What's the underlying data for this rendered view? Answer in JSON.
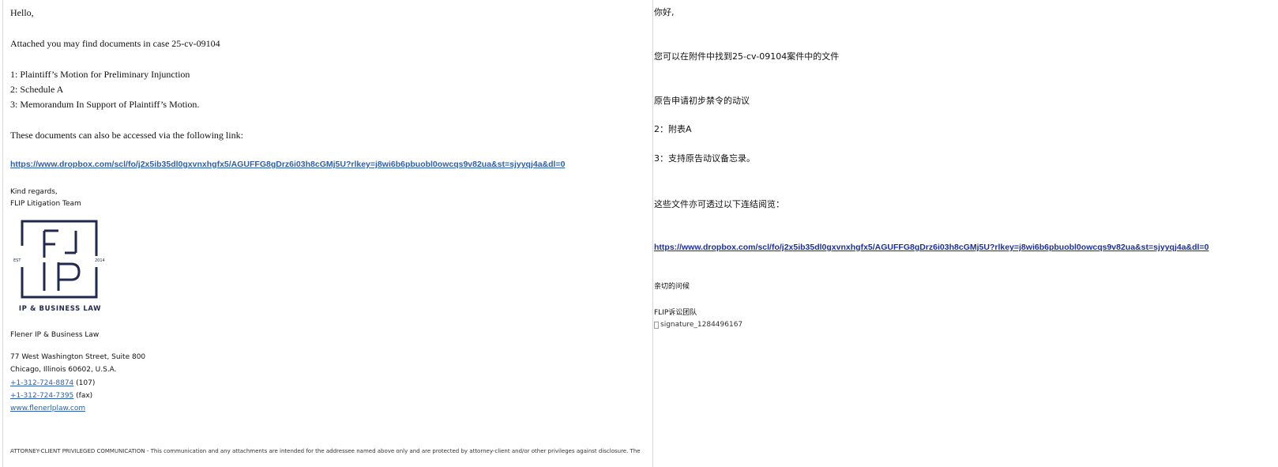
{
  "left": {
    "greeting": "Hello,",
    "intro": "Attached you may find documents in case 25-cv-09104",
    "docs": [
      "1:  Plaintiff’s Motion for Preliminary Injunction",
      "2: Schedule A",
      "3: Memorandum In Support of Plaintiff’s Motion."
    ],
    "access_text": "These documents can also be accessed via the following link:",
    "link": "https://www.dropbox.com/scl/fo/j2x5ib35dl0gxvnxhgfx5/AGUFFG8gDrz6i03h8cGMj5U?rlkey=j8wi6b6pbuobl0owcqs9v82ua&st=sjyyqj4a&dl=0",
    "regards": "Kind regards,",
    "team": "FLIP Litigation Team",
    "logo": {
      "letters_top": "F",
      "letters_bottom": "P",
      "est": "EST",
      "year": "2014",
      "caption": "IP & BUSINESS LAW",
      "color": "#1f2a4d"
    },
    "firm": "Flener IP & Business Law",
    "address1": "77 West Washington Street, Suite 800",
    "address2": "Chicago, Illinois 60602, U.S.A.",
    "phone": "+1-312-724-8874",
    "phone_ext": " (107)",
    "fax": "+1-312-724-7395",
    "fax_suffix": " (fax)",
    "website": "www.flenerlplaw.com",
    "disclaimer": "ATTORNEY-CLIENT PRIVILEGED COMMUNICATION - This communication and any attachments are intended for the addressee named above only and are protected by attorney-client and/or other privileges against disclosure. The"
  },
  "right": {
    "greeting": "你好,",
    "intro": "您可以在附件中找到25-cv-09104案件中的文件",
    "doc1": "原告申请初步禁令的动议",
    "doc2": "2：附表A",
    "doc3": "3：支持原告动议备忘录。",
    "access_text": "这些文件亦可透过以下连结阅览：",
    "link": "https://www.dropbox.com/scl/fo/j2x5ib35dl0gxvnxhgfx5/AGUFFG8gDrz6i03h8cGMj5U?rlkey=j8wi6b6pbuobl0owcqs9v82ua&st=sjyyqj4a&dl=0",
    "regards": "亲切的问候",
    "team": "FLIP诉讼团队",
    "signature_alt": "signature_1284496167"
  }
}
